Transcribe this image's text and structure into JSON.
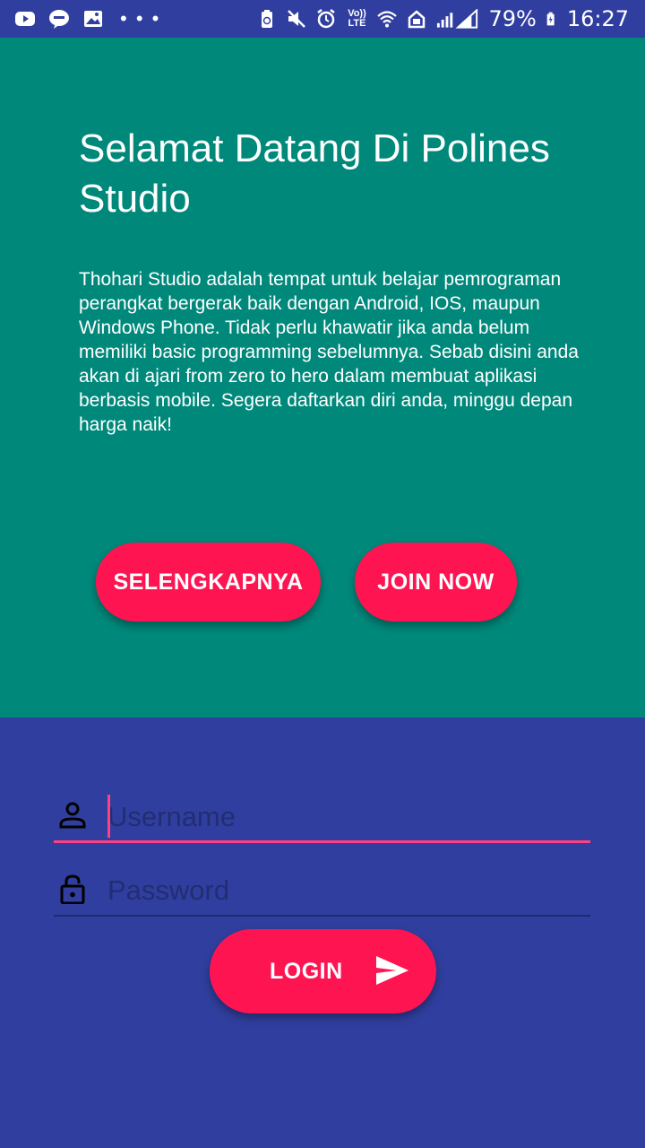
{
  "status_bar": {
    "left_icons": [
      "youtube-icon",
      "line-icon",
      "gallery-icon"
    ],
    "dots": "• • •",
    "right_icons": [
      "battery-saver-icon",
      "mute-icon",
      "alarm-icon",
      "volte-icon",
      "wifi-icon",
      "data-icon",
      "signal-icon"
    ],
    "volte_label": "Vo)) LTE",
    "battery_percent": "79%",
    "time": "16:27"
  },
  "hero": {
    "title": "Selamat Datang Di Polines Studio",
    "description": "Thohari Studio adalah tempat untuk belajar pemrograman perangkat bergerak baik dengan Android, IOS, maupun Windows Phone. Tidak perlu khawatir jika anda belum memiliki basic programming sebelumnya. Sebab disini anda akan di ajari from zero to hero dalam membuat aplikasi berbasis mobile. Segera daftarkan diri anda, minggu depan harga naik!",
    "buttons": {
      "more_label": "SELENGKAPNYA",
      "join_label": "JOIN NOW"
    }
  },
  "login": {
    "username_placeholder": "Username",
    "username_value": "",
    "password_placeholder": "Password",
    "password_value": "",
    "login_label": "LOGIN"
  },
  "colors": {
    "hero_background": "#00897B",
    "primary_dark": "#303F9F",
    "accent": "#FF1452",
    "focus_underline": "#FF4081"
  }
}
